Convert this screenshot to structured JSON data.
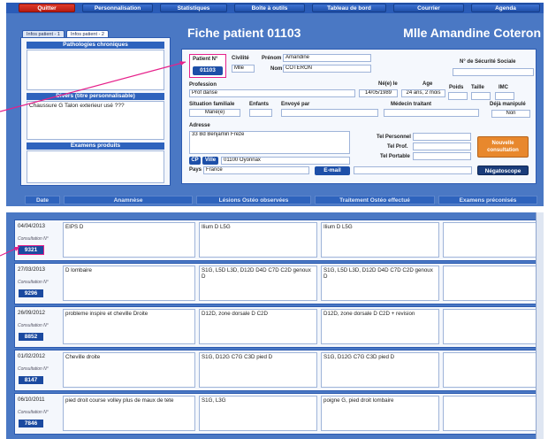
{
  "menu": [
    "Quitter",
    "Personnalisation",
    "Statistiques",
    "Boîte à outils",
    "Tableau de bord",
    "Courrier",
    "Agenda"
  ],
  "tabs": [
    "Infos patient - 1",
    "Infos patient - 2"
  ],
  "page": {
    "title": "Fiche patient 01103",
    "patient_name": "Mlle Amandine Coteron"
  },
  "left": {
    "pathologies_header": "Pathologies chroniques",
    "divers_header": "Divers (titre personnalisable)",
    "divers_text": "Chaussure G Talon exterieur usé ???",
    "examens_header": "Examens produits"
  },
  "patient": {
    "num_label": "Patient N°",
    "num": "01103",
    "civilite_label": "Civilité",
    "civilite": "Mlle",
    "prenom_label": "Prénom",
    "prenom": "Amandine",
    "nom_label": "Nom",
    "nom": "COTERON",
    "secu_label": "N° de Sécurité Sociale",
    "profession_label": "Profession",
    "profession": "Prof danse",
    "ne_label": "Né(e) le",
    "ne": "14/05/1989",
    "age_label": "Age",
    "age": "24 ans, 2 mois",
    "poids_label": "Poids",
    "taille_label": "Taille",
    "imc_label": "IMC",
    "situation_label": "Situation familiale",
    "situation": "Marié(e)",
    "enfants_label": "Enfants",
    "envoye_label": "Envoyé par",
    "medecin_label": "Médecin traitant",
    "manip_label": "Déjà manipulé",
    "manip": "Non",
    "adresse_label": "Adresse",
    "adresse": "33 Bd Benjamin Freze",
    "tel_perso_label": "Tel Personnel",
    "tel_prof_label": "Tel Prof.",
    "tel_port_label": "Tel Portable",
    "cp_label": "CP",
    "ville_label": "Ville",
    "cp_ville": "01100  Oyonnax",
    "pays_label": "Pays",
    "pays": "France",
    "email_label": "E-mail",
    "nouvelle": "Nouvelle consultation",
    "negatoscope": "Négatoscope"
  },
  "columns": [
    "Date",
    "Anamnèse",
    "Lésions Ostéo observées",
    "Traitement Ostéo effectué",
    "Examens préconisés"
  ],
  "consult_label": "Consultation N°",
  "consultations": [
    {
      "date": "04/04/2013",
      "num": "9321",
      "anamnese": "EIPS D",
      "lesions": "Ilium D L5G",
      "traitement": "Ilium D L5G"
    },
    {
      "date": "27/03/2013",
      "num": "9296",
      "anamnese": "D lombaire",
      "lesions": "S1G, L5D L3D, D12D D4D C7D C2D genoux D",
      "traitement": "S1G, L5D L3D, D12D D4D C7D C2D genoux D"
    },
    {
      "date": "26/09/2012",
      "num": "8852",
      "anamnese": "probleme inspire et cheville Droite",
      "lesions": "D12D, zone dorsale D C2D",
      "traitement": "D12D, zone dorsale D C2D + revision"
    },
    {
      "date": "01/02/2012",
      "num": "8147",
      "anamnese": "Cheville droite",
      "lesions": "S1G, D12G C7G C3D  pied D",
      "traitement": "S1G, D12G C7G C3D  pied D"
    },
    {
      "date": "06/10/2011",
      "num": "7846",
      "anamnese": "pied droit course volley plus de maux de tete",
      "lesions": "S1G, L3G",
      "traitement": "poigne G, pied droit lombaire"
    }
  ]
}
